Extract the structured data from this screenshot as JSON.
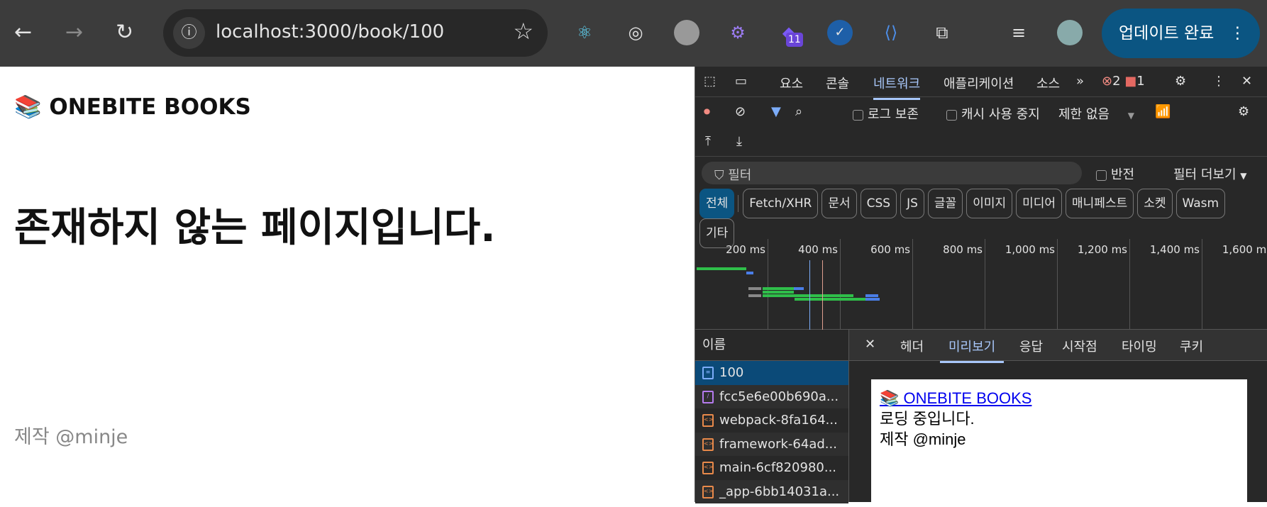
{
  "browser": {
    "url": "localhost:3000/book/100",
    "update_label": "업데이트 완료",
    "extension_badge": "11"
  },
  "page": {
    "brand": "📚 ONEBITE BOOKS",
    "heading": "존재하지 않는 페이지입니다.",
    "footer": "제작 @minje"
  },
  "devtools": {
    "tabs": [
      "요소",
      "콘솔",
      "네트워크",
      "애플리케이션",
      "소스"
    ],
    "errors": "2",
    "warnings": "1",
    "preserve_log": "로그 보존",
    "disable_cache": "캐시 사용 중지",
    "throttle": "제한 없음",
    "filter_placeholder": "필터",
    "invert": "반전",
    "more_filters": "필터 더보기",
    "chips": [
      "전체",
      "Fetch/XHR",
      "문서",
      "CSS",
      "JS",
      "글꼴",
      "이미지",
      "미디어",
      "매니페스트",
      "소켓",
      "Wasm",
      "기타"
    ],
    "ticks": [
      "200 ms",
      "400 ms",
      "600 ms",
      "800 ms",
      "1,000 ms",
      "1,200 ms",
      "1,400 ms",
      "1,600 ms"
    ],
    "name_header": "이름",
    "requests": [
      "100",
      "fcc5e6e00b690a...",
      "webpack-8fa164...",
      "framework-64ad...",
      "main-6cf820980...",
      "_app-6bb14031a..."
    ],
    "detail_tabs": [
      "헤더",
      "미리보기",
      "응답",
      "시작점",
      "타이밍",
      "쿠키"
    ],
    "preview": {
      "link": "📚 ONEBITE BOOKS",
      "loading": "로딩 중입니다.",
      "footer": "제작 @minje"
    }
  }
}
